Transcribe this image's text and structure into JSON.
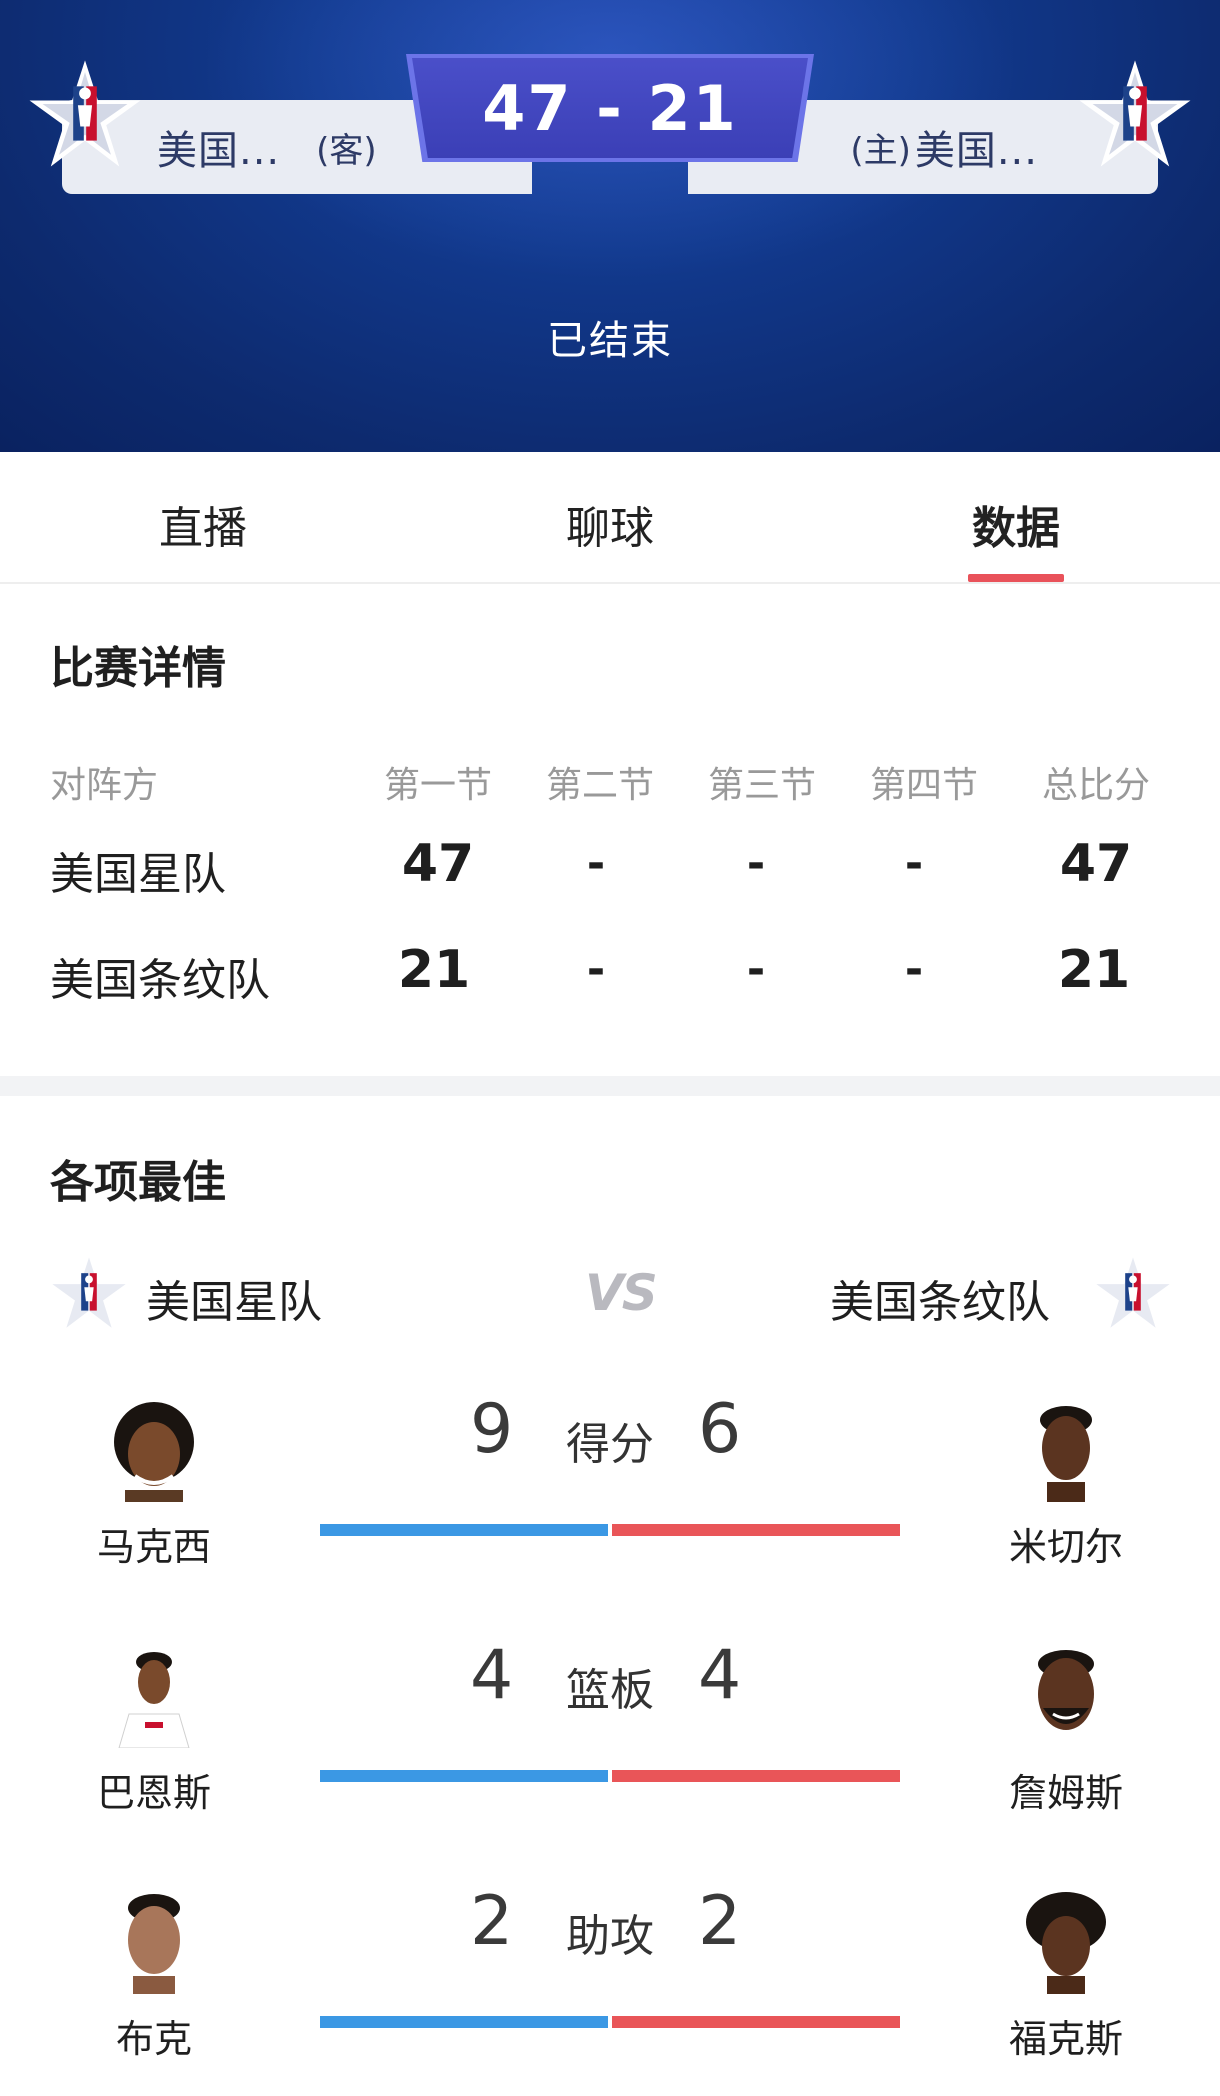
{
  "header": {
    "away_team": "美国...",
    "away_tag": "(客)",
    "home_tag": "(主)",
    "home_team": "美国...",
    "score": "47 - 21",
    "status": "已结束"
  },
  "tabs": [
    {
      "label": "直播"
    },
    {
      "label": "聊球"
    },
    {
      "label": "数据"
    }
  ],
  "match_details": {
    "title": "比赛详情",
    "columns": [
      "对阵方",
      "第一节",
      "第二节",
      "第三节",
      "第四节",
      "总比分"
    ],
    "rows": [
      {
        "team": "美国星队",
        "q1": "47",
        "q2": "-",
        "q3": "-",
        "q4": "-",
        "total": "47"
      },
      {
        "team": "美国条纹队",
        "q1": "21",
        "q2": "-",
        "q3": "-",
        "q4": "-",
        "total": "21"
      }
    ]
  },
  "leaders": {
    "title": "各项最佳",
    "left_team": "美国星队",
    "vs": "VS",
    "right_team": "美国条纹队",
    "stats": [
      {
        "label": "得分",
        "left_value": "9",
        "right_value": "6",
        "left_player": "马克西",
        "right_player": "米切尔"
      },
      {
        "label": "篮板",
        "left_value": "4",
        "right_value": "4",
        "left_player": "巴恩斯",
        "right_player": "詹姆斯"
      },
      {
        "label": "助攻",
        "left_value": "2",
        "right_value": "2",
        "left_player": "布克",
        "right_player": "福克斯"
      }
    ]
  },
  "colors": {
    "header_blue": "#123a8f",
    "score_box": "#3b3fb6",
    "tab_underline": "#e9525a",
    "bar_blue": "#3b98e4",
    "bar_red": "#e95558"
  }
}
